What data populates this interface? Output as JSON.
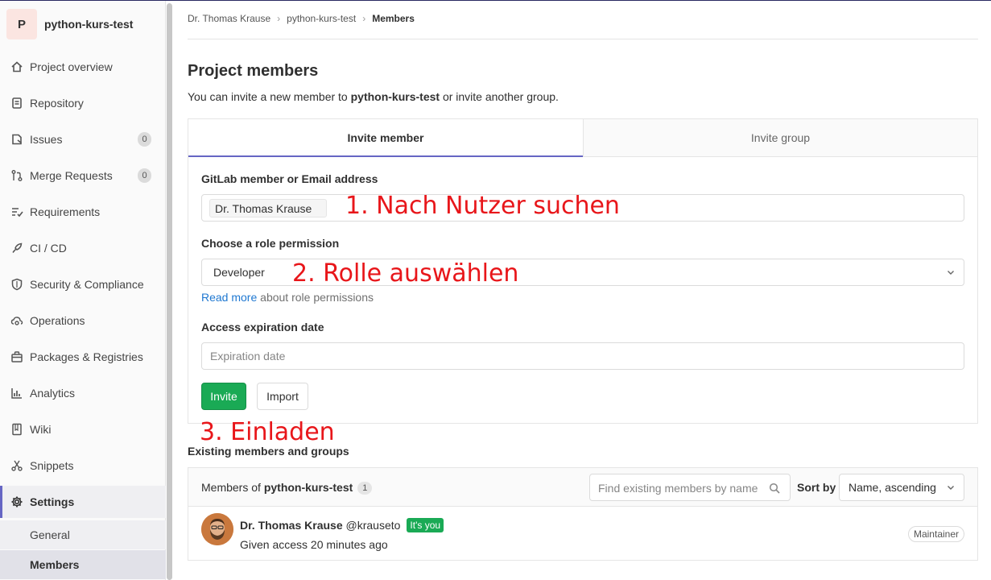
{
  "project": {
    "initial": "P",
    "name": "python-kurs-test"
  },
  "sidebar": {
    "items": [
      {
        "label": "Project overview",
        "icon": "home-icon"
      },
      {
        "label": "Repository",
        "icon": "doc-icon"
      },
      {
        "label": "Issues",
        "icon": "issues-icon",
        "count": "0"
      },
      {
        "label": "Merge Requests",
        "icon": "merge-request-icon",
        "count": "0"
      },
      {
        "label": "Requirements",
        "icon": "requirements-icon"
      },
      {
        "label": "CI / CD",
        "icon": "rocket-icon"
      },
      {
        "label": "Security & Compliance",
        "icon": "shield-icon"
      },
      {
        "label": "Operations",
        "icon": "cloud-gear-icon"
      },
      {
        "label": "Packages & Registries",
        "icon": "package-icon"
      },
      {
        "label": "Analytics",
        "icon": "chart-icon"
      },
      {
        "label": "Wiki",
        "icon": "book-icon"
      },
      {
        "label": "Snippets",
        "icon": "scissors-icon"
      },
      {
        "label": "Settings",
        "icon": "settings-icon"
      }
    ],
    "sub": {
      "general": "General",
      "members": "Members"
    }
  },
  "breadcrumb": {
    "owner": "Dr. Thomas Krause",
    "project": "python-kurs-test",
    "current": "Members"
  },
  "page": {
    "title": "Project members",
    "subtitle_pre": "You can invite a new member to ",
    "subtitle_project": "python-kurs-test",
    "subtitle_post": " or invite another group."
  },
  "tabs": {
    "invite_member": "Invite member",
    "invite_group": "Invite group"
  },
  "form": {
    "member_label": "GitLab member or Email address",
    "member_token": "Dr. Thomas Krause",
    "role_label": "Choose a role permission",
    "role_value": "Developer",
    "help_link": "Read more",
    "help_text": " about role permissions",
    "expiry_label": "Access expiration date",
    "expiry_placeholder": "Expiration date",
    "invite_button": "Invite",
    "import_button": "Import"
  },
  "annotations": {
    "step1": "1. Nach Nutzer suchen",
    "step2": "2. Rolle auswählen",
    "step3": "3. Einladen"
  },
  "existing": {
    "title": "Existing members and groups",
    "members_of": "Members of ",
    "project": "python-kurs-test",
    "count": "1",
    "search_placeholder": "Find existing members by name",
    "sort_label": "Sort by",
    "sort_value": "Name, ascending",
    "member": {
      "name": "Dr. Thomas Krause",
      "username": " @krauseto",
      "you_badge": "It's you",
      "access": "Given access 20 minutes ago",
      "role": "Maintainer"
    }
  },
  "colors": {
    "accent": "#6666c4",
    "success": "#1aaa55",
    "annotation": "#e8161a",
    "link": "#1f78d1"
  }
}
